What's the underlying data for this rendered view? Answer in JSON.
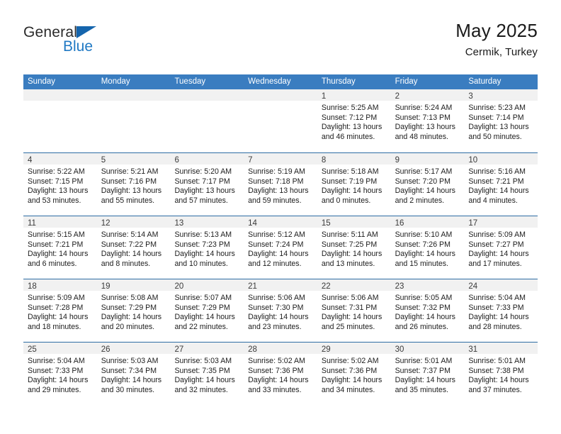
{
  "brand": {
    "name_part1": "General",
    "name_part2": "Blue",
    "flag_icon": "blue-triangle-flag"
  },
  "header": {
    "title": "May 2025",
    "subtitle": "Cermik, Turkey"
  },
  "calendar": {
    "weekday_headers": [
      "Sunday",
      "Monday",
      "Tuesday",
      "Wednesday",
      "Thursday",
      "Friday",
      "Saturday"
    ],
    "accent_color": "#3a7dc0",
    "separator_color": "#2e6da4",
    "day_band_color": "#f1f1f1",
    "weeks": [
      [
        {
          "empty": true
        },
        {
          "empty": true
        },
        {
          "empty": true
        },
        {
          "empty": true
        },
        {
          "day": "1",
          "sunrise": "Sunrise: 5:25 AM",
          "sunset": "Sunset: 7:12 PM",
          "daylight_line1": "Daylight: 13 hours",
          "daylight_line2": "and 46 minutes."
        },
        {
          "day": "2",
          "sunrise": "Sunrise: 5:24 AM",
          "sunset": "Sunset: 7:13 PM",
          "daylight_line1": "Daylight: 13 hours",
          "daylight_line2": "and 48 minutes."
        },
        {
          "day": "3",
          "sunrise": "Sunrise: 5:23 AM",
          "sunset": "Sunset: 7:14 PM",
          "daylight_line1": "Daylight: 13 hours",
          "daylight_line2": "and 50 minutes."
        }
      ],
      [
        {
          "day": "4",
          "sunrise": "Sunrise: 5:22 AM",
          "sunset": "Sunset: 7:15 PM",
          "daylight_line1": "Daylight: 13 hours",
          "daylight_line2": "and 53 minutes."
        },
        {
          "day": "5",
          "sunrise": "Sunrise: 5:21 AM",
          "sunset": "Sunset: 7:16 PM",
          "daylight_line1": "Daylight: 13 hours",
          "daylight_line2": "and 55 minutes."
        },
        {
          "day": "6",
          "sunrise": "Sunrise: 5:20 AM",
          "sunset": "Sunset: 7:17 PM",
          "daylight_line1": "Daylight: 13 hours",
          "daylight_line2": "and 57 minutes."
        },
        {
          "day": "7",
          "sunrise": "Sunrise: 5:19 AM",
          "sunset": "Sunset: 7:18 PM",
          "daylight_line1": "Daylight: 13 hours",
          "daylight_line2": "and 59 minutes."
        },
        {
          "day": "8",
          "sunrise": "Sunrise: 5:18 AM",
          "sunset": "Sunset: 7:19 PM",
          "daylight_line1": "Daylight: 14 hours",
          "daylight_line2": "and 0 minutes."
        },
        {
          "day": "9",
          "sunrise": "Sunrise: 5:17 AM",
          "sunset": "Sunset: 7:20 PM",
          "daylight_line1": "Daylight: 14 hours",
          "daylight_line2": "and 2 minutes."
        },
        {
          "day": "10",
          "sunrise": "Sunrise: 5:16 AM",
          "sunset": "Sunset: 7:21 PM",
          "daylight_line1": "Daylight: 14 hours",
          "daylight_line2": "and 4 minutes."
        }
      ],
      [
        {
          "day": "11",
          "sunrise": "Sunrise: 5:15 AM",
          "sunset": "Sunset: 7:21 PM",
          "daylight_line1": "Daylight: 14 hours",
          "daylight_line2": "and 6 minutes."
        },
        {
          "day": "12",
          "sunrise": "Sunrise: 5:14 AM",
          "sunset": "Sunset: 7:22 PM",
          "daylight_line1": "Daylight: 14 hours",
          "daylight_line2": "and 8 minutes."
        },
        {
          "day": "13",
          "sunrise": "Sunrise: 5:13 AM",
          "sunset": "Sunset: 7:23 PM",
          "daylight_line1": "Daylight: 14 hours",
          "daylight_line2": "and 10 minutes."
        },
        {
          "day": "14",
          "sunrise": "Sunrise: 5:12 AM",
          "sunset": "Sunset: 7:24 PM",
          "daylight_line1": "Daylight: 14 hours",
          "daylight_line2": "and 12 minutes."
        },
        {
          "day": "15",
          "sunrise": "Sunrise: 5:11 AM",
          "sunset": "Sunset: 7:25 PM",
          "daylight_line1": "Daylight: 14 hours",
          "daylight_line2": "and 13 minutes."
        },
        {
          "day": "16",
          "sunrise": "Sunrise: 5:10 AM",
          "sunset": "Sunset: 7:26 PM",
          "daylight_line1": "Daylight: 14 hours",
          "daylight_line2": "and 15 minutes."
        },
        {
          "day": "17",
          "sunrise": "Sunrise: 5:09 AM",
          "sunset": "Sunset: 7:27 PM",
          "daylight_line1": "Daylight: 14 hours",
          "daylight_line2": "and 17 minutes."
        }
      ],
      [
        {
          "day": "18",
          "sunrise": "Sunrise: 5:09 AM",
          "sunset": "Sunset: 7:28 PM",
          "daylight_line1": "Daylight: 14 hours",
          "daylight_line2": "and 18 minutes."
        },
        {
          "day": "19",
          "sunrise": "Sunrise: 5:08 AM",
          "sunset": "Sunset: 7:29 PM",
          "daylight_line1": "Daylight: 14 hours",
          "daylight_line2": "and 20 minutes."
        },
        {
          "day": "20",
          "sunrise": "Sunrise: 5:07 AM",
          "sunset": "Sunset: 7:29 PM",
          "daylight_line1": "Daylight: 14 hours",
          "daylight_line2": "and 22 minutes."
        },
        {
          "day": "21",
          "sunrise": "Sunrise: 5:06 AM",
          "sunset": "Sunset: 7:30 PM",
          "daylight_line1": "Daylight: 14 hours",
          "daylight_line2": "and 23 minutes."
        },
        {
          "day": "22",
          "sunrise": "Sunrise: 5:06 AM",
          "sunset": "Sunset: 7:31 PM",
          "daylight_line1": "Daylight: 14 hours",
          "daylight_line2": "and 25 minutes."
        },
        {
          "day": "23",
          "sunrise": "Sunrise: 5:05 AM",
          "sunset": "Sunset: 7:32 PM",
          "daylight_line1": "Daylight: 14 hours",
          "daylight_line2": "and 26 minutes."
        },
        {
          "day": "24",
          "sunrise": "Sunrise: 5:04 AM",
          "sunset": "Sunset: 7:33 PM",
          "daylight_line1": "Daylight: 14 hours",
          "daylight_line2": "and 28 minutes."
        }
      ],
      [
        {
          "day": "25",
          "sunrise": "Sunrise: 5:04 AM",
          "sunset": "Sunset: 7:33 PM",
          "daylight_line1": "Daylight: 14 hours",
          "daylight_line2": "and 29 minutes."
        },
        {
          "day": "26",
          "sunrise": "Sunrise: 5:03 AM",
          "sunset": "Sunset: 7:34 PM",
          "daylight_line1": "Daylight: 14 hours",
          "daylight_line2": "and 30 minutes."
        },
        {
          "day": "27",
          "sunrise": "Sunrise: 5:03 AM",
          "sunset": "Sunset: 7:35 PM",
          "daylight_line1": "Daylight: 14 hours",
          "daylight_line2": "and 32 minutes."
        },
        {
          "day": "28",
          "sunrise": "Sunrise: 5:02 AM",
          "sunset": "Sunset: 7:36 PM",
          "daylight_line1": "Daylight: 14 hours",
          "daylight_line2": "and 33 minutes."
        },
        {
          "day": "29",
          "sunrise": "Sunrise: 5:02 AM",
          "sunset": "Sunset: 7:36 PM",
          "daylight_line1": "Daylight: 14 hours",
          "daylight_line2": "and 34 minutes."
        },
        {
          "day": "30",
          "sunrise": "Sunrise: 5:01 AM",
          "sunset": "Sunset: 7:37 PM",
          "daylight_line1": "Daylight: 14 hours",
          "daylight_line2": "and 35 minutes."
        },
        {
          "day": "31",
          "sunrise": "Sunrise: 5:01 AM",
          "sunset": "Sunset: 7:38 PM",
          "daylight_line1": "Daylight: 14 hours",
          "daylight_line2": "and 37 minutes."
        }
      ]
    ]
  }
}
